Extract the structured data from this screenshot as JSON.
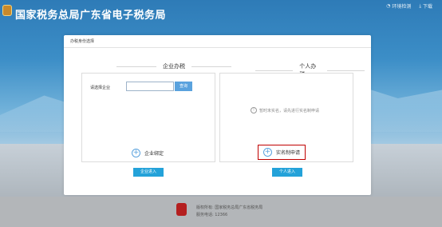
{
  "header": {
    "title": "国家税务总局广东省电子税务局",
    "links": [
      {
        "label": "环境检测",
        "icon": "monitor-icon"
      },
      {
        "label": "下载",
        "icon": "download-icon"
      }
    ]
  },
  "card": {
    "heading": "办税身份选择",
    "enterprise": {
      "title": "企业办税",
      "select_label": "请选择企业",
      "input_value": "",
      "query_label": "查询",
      "bind_label": "企业绑定",
      "enter_label": "企业进入"
    },
    "personal": {
      "title": "个人办税",
      "notice": "暂时未实名，请先进行实名制申请",
      "apply_label": "实名制申请",
      "enter_label": "个人进入"
    }
  },
  "footer": {
    "owner_prefix": "版权所有:",
    "owner": "国家税务总局广东省税务局",
    "hotline_prefix": "服务电话:",
    "hotline": "12366"
  },
  "colors": {
    "header_blue": "#2e7bb7",
    "button_blue": "#24a2d9",
    "highlight_red": "#c00000"
  }
}
